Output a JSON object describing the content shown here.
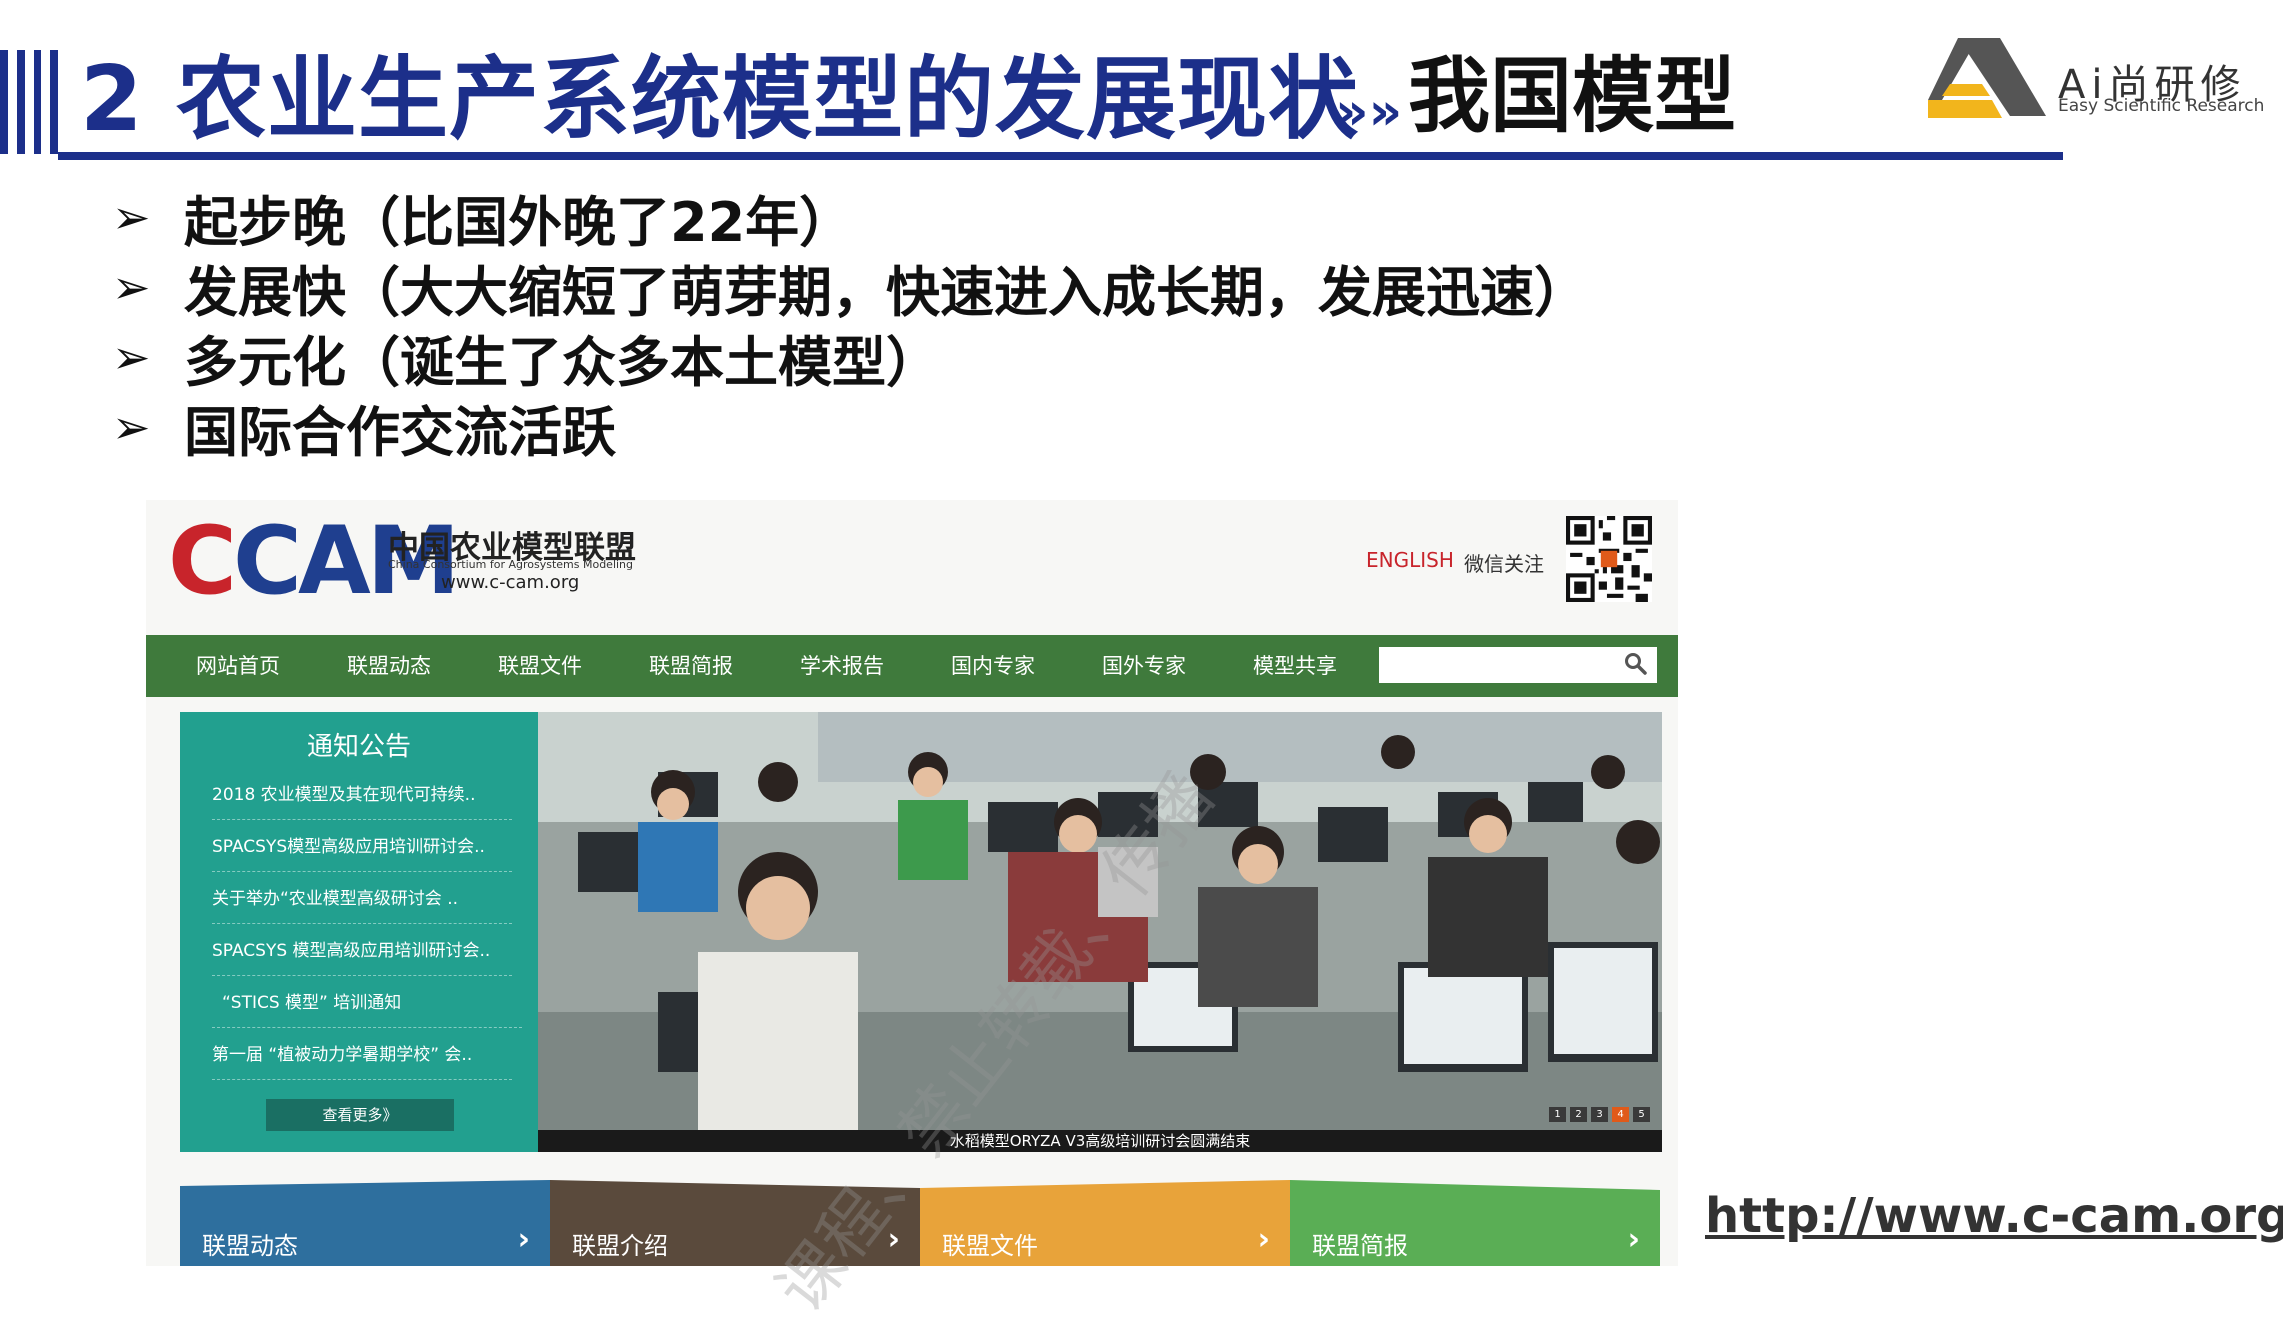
{
  "header": {
    "title": "2 农业生产系统模型的发展现状",
    "separator": "»»",
    "subtitle": "我国模型"
  },
  "logo": {
    "name": "Ai尚研修",
    "tagline": "Easy Scientific Research"
  },
  "bullets": [
    "起步晚（比国外晚了22年）",
    "发展快（大大缩短了萌芽期，快速进入成长期，发展迅速）",
    "多元化（诞生了众多本土模型）",
    "国际合作交流活跃"
  ],
  "bullet_marker": "➢",
  "website": {
    "logo_text": "CAM",
    "org_name": "中国农业模型联盟",
    "org_name_en": "China Consortium for Agrosystems Modeling",
    "url": "www.c-cam.org",
    "english_link": "ENGLISH",
    "wechat_label": "微信关注",
    "nav": [
      "网站首页",
      "联盟动态",
      "联盟文件",
      "联盟简报",
      "学术报告",
      "国内专家",
      "国外专家",
      "模型共享"
    ],
    "search_placeholder": "",
    "notice": {
      "title": "通知公告",
      "items": [
        "2018 农业模型及其在现代可持续..",
        "SPACSYS模型高级应用培训研讨会..",
        "关于举办“农业模型高级研讨会 ..",
        "SPACSYS 模型高级应用培训研讨会..",
        "“STICS 模型” 培训通知",
        "第一届 “植被动力学暑期学校” 会.."
      ],
      "more_label": "查看更多》"
    },
    "banner_caption": "水稻模型ORYZA V3高级培训研讨会圆满结束",
    "slider_pages": [
      "1",
      "2",
      "3",
      "4",
      "5"
    ],
    "slider_active": 4,
    "tabs": [
      {
        "label": "联盟动态",
        "color": "#2e6f9e"
      },
      {
        "label": "联盟介绍",
        "color": "#5a4a3c"
      },
      {
        "label": "联盟文件",
        "color": "#e8a33a"
      },
      {
        "label": "联盟简报",
        "color": "#5aae55"
      }
    ]
  },
  "link_url": "http://www.c-cam.org/",
  "watermark": "课程、禁止转载、传播",
  "colors": {
    "title_blue": "#1c2f8a",
    "nav_green": "#3f7a3c",
    "notice_teal": "#22a08f",
    "cam_red": "#c8242b"
  }
}
